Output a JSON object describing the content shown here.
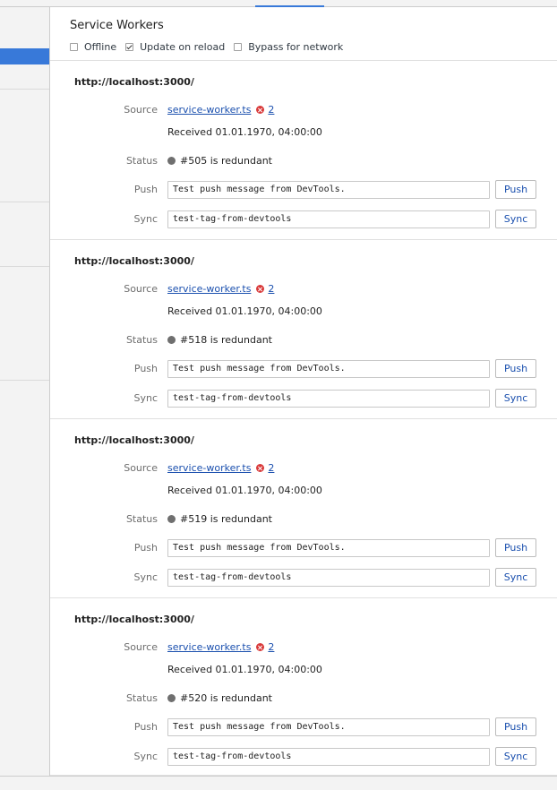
{
  "panel": {
    "title": "Service Workers",
    "options": [
      {
        "label": "Offline",
        "checked": false
      },
      {
        "label": "Update on reload",
        "checked": true
      },
      {
        "label": "Bypass for network",
        "checked": false
      }
    ]
  },
  "labels": {
    "source": "Source",
    "status": "Status",
    "push": "Push",
    "sync": "Sync"
  },
  "workers": [
    {
      "origin": "http://localhost:3000/",
      "source_file": "service-worker.ts",
      "error_count": "2",
      "received": "Received 01.01.1970, 04:00:00",
      "status": "#505 is redundant",
      "push_value": "Test push message from DevTools.",
      "push_button": "Push",
      "sync_value": "test-tag-from-devtools",
      "sync_button": "Sync"
    },
    {
      "origin": "http://localhost:3000/",
      "source_file": "service-worker.ts",
      "error_count": "2",
      "received": "Received 01.01.1970, 04:00:00",
      "status": "#518 is redundant",
      "push_value": "Test push message from DevTools.",
      "push_button": "Push",
      "sync_value": "test-tag-from-devtools",
      "sync_button": "Sync"
    },
    {
      "origin": "http://localhost:3000/",
      "source_file": "service-worker.ts",
      "error_count": "2",
      "received": "Received 01.01.1970, 04:00:00",
      "status": "#519 is redundant",
      "push_value": "Test push message from DevTools.",
      "push_button": "Push",
      "sync_value": "test-tag-from-devtools",
      "sync_button": "Sync"
    },
    {
      "origin": "http://localhost:3000/",
      "source_file": "service-worker.ts",
      "error_count": "2",
      "received": "Received 01.01.1970, 04:00:00",
      "status": "#520 is redundant",
      "push_value": "Test push message from DevTools.",
      "push_button": "Push",
      "sync_value": "test-tag-from-devtools",
      "sync_button": "Sync"
    }
  ]
}
